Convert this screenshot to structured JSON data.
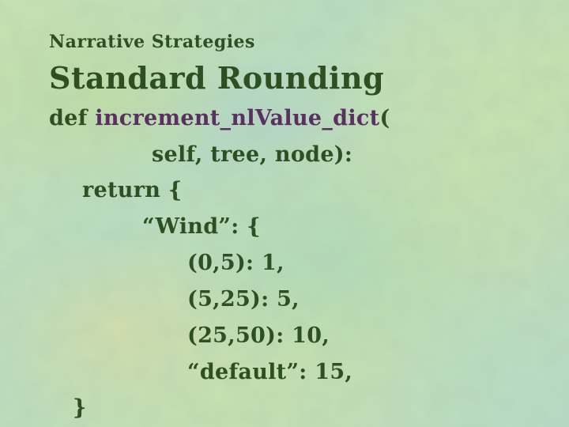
{
  "slide": {
    "subtitle": "Narrative Strategies",
    "title": "Standard Rounding",
    "code": {
      "line1_keyword": "def ",
      "line1_function": "increment_nlValue_dict",
      "line1_paren": "(",
      "line2": "self, tree, node):",
      "line3": "return {",
      "line4": "“Wind”: {",
      "line5": "(0,5): 1,",
      "line6": "(5,25): 5,",
      "line7": "(25,50): 10,",
      "line8": "“default”: 15,",
      "line9": "}"
    }
  },
  "colors": {
    "text": "#2e4f22",
    "function_name": "#5a3060"
  }
}
